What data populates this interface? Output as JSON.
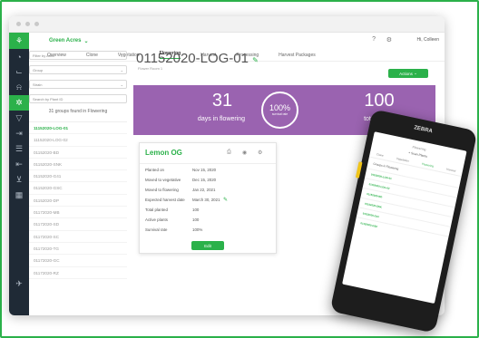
{
  "app": {
    "brand": "Green Acres",
    "user": "Hi, Colleen"
  },
  "nav": [
    "Overview",
    "Clone",
    "Vegetation",
    "Flowering",
    "Harvest",
    "Processing",
    "Harvest Packages"
  ],
  "filters": [
    "Filter by Area",
    "Group",
    "Strain",
    "Search by Plant ID"
  ],
  "count_text": "31 groups found in Flowering",
  "groups": [
    "11152020-LOG-01",
    "11152020-LOG-02",
    "01152020-BD",
    "01152020-SNK",
    "01152020-G41",
    "01152020-GSC",
    "01152020-DP",
    "01172020-MB",
    "01172020-SD",
    "01172020-SC",
    "01172020-TG",
    "01172020-GC",
    "01172020-RZ"
  ],
  "batch": {
    "title": "01152020-LOG-01",
    "subtitle": "Flower Room 1",
    "actions": "Actions"
  },
  "stats": {
    "days": "31",
    "days_label": "days in flowering",
    "survival": "100%",
    "survival_label": "survival rate",
    "plants": "100",
    "plants_label": "total plants"
  },
  "card": {
    "strain": "Lemon OG",
    "rows": [
      {
        "k": "Planted on",
        "v": "Nov 15, 2020"
      },
      {
        "k": "Moved to vegetative",
        "v": "Dec 15, 2020"
      },
      {
        "k": "Moved to flowering",
        "v": "Jan 22, 2021"
      },
      {
        "k": "Expected harvest date",
        "v": "March 30, 2021"
      },
      {
        "k": "Total planted",
        "v": "100"
      },
      {
        "k": "Active plants",
        "v": "100"
      },
      {
        "k": "Survival rate",
        "v": "100%"
      }
    ],
    "edit": "Edit"
  },
  "device": {
    "brand": "ZEBRA",
    "title": "Flowering",
    "scan": "Scan Plants",
    "tabs": [
      "Clone",
      "Vegetation",
      "Flowering",
      "Harvest"
    ],
    "heading": "Groups in Flowering",
    "rows": [
      "01152020-LOG-01",
      "01152020-LOG-02",
      "01152020-BD",
      "01152020-SNK",
      "01152020-G41",
      "01152020-GSC"
    ]
  },
  "colors": {
    "accent": "#2bb14a",
    "band": "#9a63b0",
    "rail": "#1f2a36"
  }
}
